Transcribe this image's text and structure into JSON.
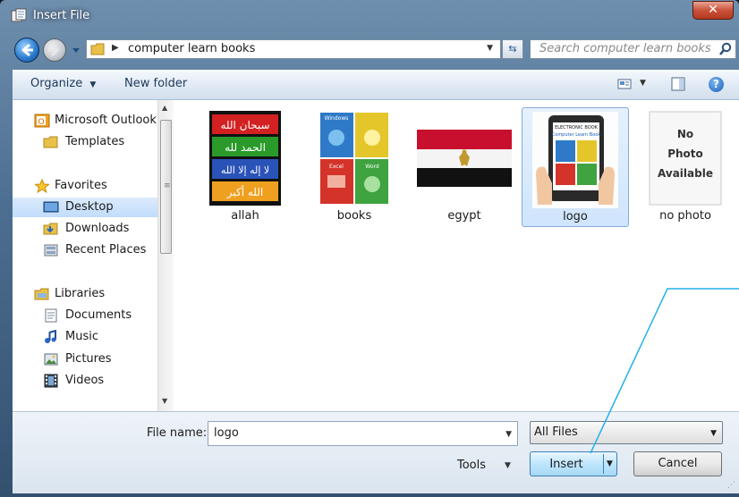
{
  "window": {
    "title": "Insert File",
    "close_label": "✕"
  },
  "nav": {
    "breadcrumb": "computer learn books",
    "search_placeholder": "Search computer learn books"
  },
  "toolbar": {
    "organize": "Organize",
    "new_folder": "New folder"
  },
  "sidebar": {
    "items": [
      {
        "label": "Microsoft Outlook",
        "icon": "outlook-icon"
      },
      {
        "label": "Templates",
        "icon": "folder-icon"
      },
      {
        "label": "Favorites",
        "icon": "star-icon"
      },
      {
        "label": "Desktop",
        "icon": "desktop-icon"
      },
      {
        "label": "Downloads",
        "icon": "downloads-icon"
      },
      {
        "label": "Recent Places",
        "icon": "recent-places-icon"
      },
      {
        "label": "Libraries",
        "icon": "libraries-icon"
      },
      {
        "label": "Documents",
        "icon": "documents-icon"
      },
      {
        "label": "Music",
        "icon": "music-icon"
      },
      {
        "label": "Pictures",
        "icon": "pictures-icon"
      },
      {
        "label": "Videos",
        "icon": "videos-icon"
      }
    ]
  },
  "files": [
    {
      "name": "allah",
      "thumb_lines": [
        "سبحان الله",
        "الحمد لله",
        "لا إله إلا الله",
        "الله أكبر"
      ]
    },
    {
      "name": "books",
      "tiles": [
        "Windows",
        "Excel",
        "Word"
      ]
    },
    {
      "name": "egypt"
    },
    {
      "name": "logo",
      "book_title": "ELECTRONIC BOOK",
      "book_subtitle": "Computer Learn Book"
    },
    {
      "name": "no photo",
      "placeholder_text": "No Photo Available"
    }
  ],
  "footer": {
    "file_name_label": "File name:",
    "file_name_value": "logo",
    "file_type": "All Files",
    "tools": "Tools",
    "insert": "Insert",
    "cancel": "Cancel"
  },
  "colors": {
    "selection": "#cfe5fc",
    "callout_line": "#23b2e8",
    "title_gradient": "#4d6f92"
  }
}
